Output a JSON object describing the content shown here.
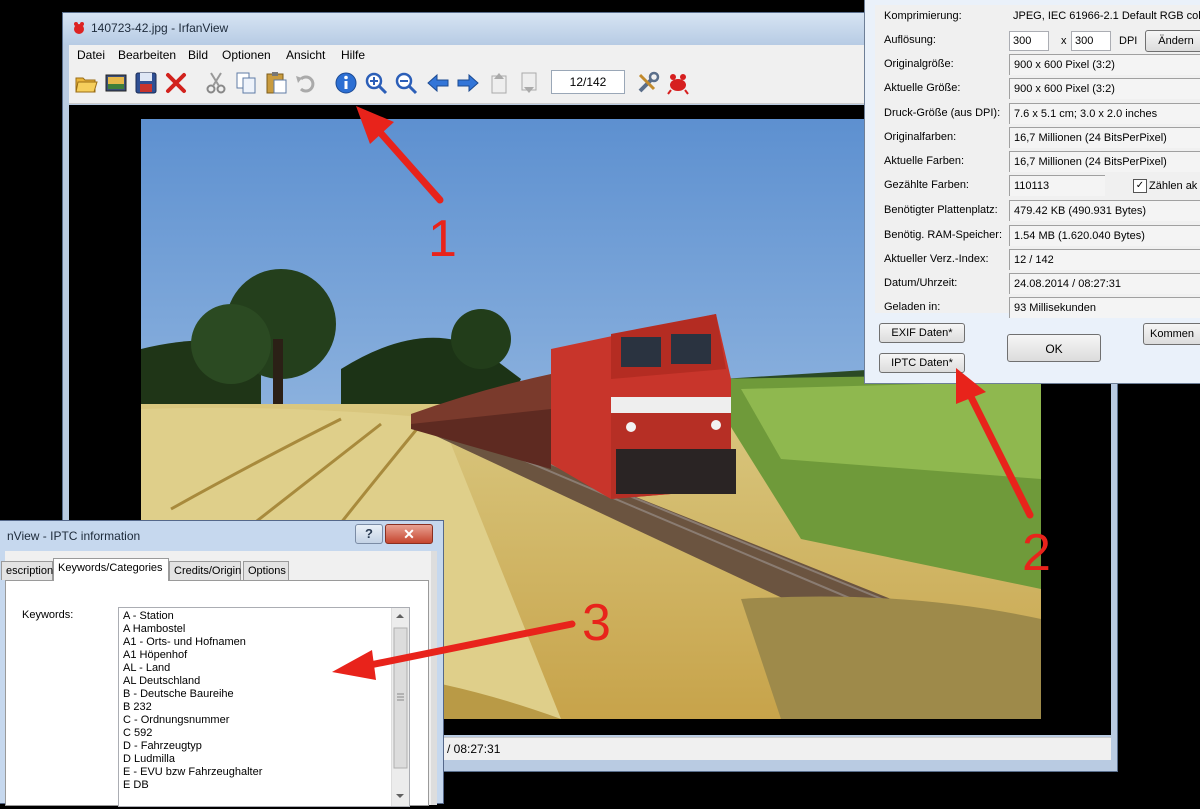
{
  "main_window": {
    "title": "140723-42.jpg - IrfanView",
    "menu": [
      "Datei",
      "Bearbeiten",
      "Bild",
      "Optionen",
      "Ansicht",
      "Hilfe"
    ],
    "page_counter": "12/142",
    "status_time": "/ 08:27:31",
    "toolbar_icons": [
      "open-folder-icon",
      "thumbnails-icon",
      "save-icon",
      "delete-icon",
      "cut-icon",
      "copy-icon",
      "paste-icon",
      "undo-icon",
      "info-icon",
      "zoom-in-icon",
      "zoom-out-icon",
      "previous-icon",
      "next-icon",
      "first-page-icon",
      "last-page-icon",
      "settings-icon",
      "irfanview-icon"
    ]
  },
  "info_dialog": {
    "rows": [
      {
        "label": "Komprimierung:",
        "value": "JPEG, IEC 61966-2.1 Default RGB colo"
      },
      {
        "label": "Auflösung:",
        "value": ""
      },
      {
        "label": "Originalgröße:",
        "value": "900 x 600  Pixel (3:2)"
      },
      {
        "label": "Aktuelle Größe:",
        "value": "900 x 600  Pixel (3:2)"
      },
      {
        "label": "Druck-Größe (aus DPI):",
        "value": "7.6 x 5.1 cm; 3.0 x 2.0 inches"
      },
      {
        "label": "Originalfarben:",
        "value": "16,7 Millionen   (24 BitsPerPixel)"
      },
      {
        "label": "Aktuelle Farben:",
        "value": "16,7 Millionen   (24 BitsPerPixel)"
      },
      {
        "label": "Gezählte Farben:",
        "value": "110113"
      },
      {
        "label": "Benötigter Plattenplatz:",
        "value": "479.42 KB (490.931 Bytes)"
      },
      {
        "label": "Benötig. RAM-Speicher:",
        "value": "1.54  MB (1.620.040 Bytes)"
      },
      {
        "label": "Aktueller Verz.-Index:",
        "value": "12  /  142"
      },
      {
        "label": "Datum/Uhrzeit:",
        "value": "24.08.2014 / 08:27:31"
      },
      {
        "label": "Geladen in:",
        "value": "93 Millisekunden"
      }
    ],
    "dpi_x": "300",
    "dpi_sep": "x",
    "dpi_y": "300",
    "dpi_unit": "DPI",
    "change_button": "Ändern",
    "count_checkbox": "Zählen ak",
    "exif_button": "EXIF Daten*",
    "iptc_button": "IPTC Daten*",
    "ok_button": "OK",
    "comment_button": "Kommen"
  },
  "iptc_dialog": {
    "title": "nView - IPTC information",
    "help": "?",
    "close": "✕",
    "tabs": [
      "escription",
      "Keywords/Categories",
      "Credits/Origin",
      "Options"
    ],
    "active_tab": 1,
    "keywords_label": "Keywords:",
    "keywords": [
      "A - Station",
      "A Hambostel",
      "A1 - Orts- und Hofnamen",
      "A1 Höpenhof",
      "AL - Land",
      "AL Deutschland",
      "B - Deutsche Baureihe",
      "B 232",
      "C - Ordnungsnummer",
      "C 592",
      "D - Fahrzeugtyp",
      "D Ludmilla",
      "E - EVU bzw Fahrzeughalter",
      "E DB"
    ]
  },
  "annotations": [
    "1",
    "2",
    "3"
  ],
  "colors": {
    "arrow": "#e8231b",
    "titlebar": "#c6d8ee",
    "loco": "#c8352b"
  }
}
